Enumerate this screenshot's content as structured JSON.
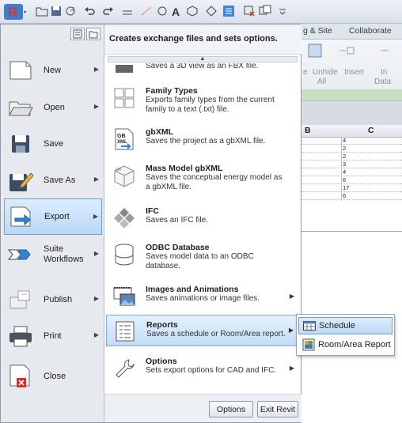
{
  "ribbon": {
    "tabs": [
      "g & Site",
      "Collaborate"
    ],
    "button_labels": [
      "e",
      "Unhide",
      "All",
      "Insert",
      "In",
      "Data"
    ]
  },
  "sheet": {
    "col_b": "B",
    "col_c": "C",
    "values": [
      "4",
      "2",
      "2",
      "3",
      "4",
      "6",
      "17",
      "6"
    ]
  },
  "menu": {
    "left_items": [
      {
        "label": "New",
        "has_arrow": true,
        "icon": "new-document-icon"
      },
      {
        "label": "Open",
        "has_arrow": true,
        "icon": "open-folder-icon"
      },
      {
        "label": "Save",
        "has_arrow": false,
        "icon": "floppy-disk-icon"
      },
      {
        "label": "Save As",
        "has_arrow": true,
        "icon": "save-as-icon"
      },
      {
        "label": "Export",
        "has_arrow": true,
        "icon": "export-icon",
        "active": true
      },
      {
        "label": "Suite Workflows",
        "has_arrow": true,
        "icon": "suite-workflows-icon"
      },
      {
        "label": "Publish",
        "has_arrow": true,
        "icon": "publish-icon"
      },
      {
        "label": "Print",
        "has_arrow": true,
        "icon": "printer-icon"
      },
      {
        "label": "Close",
        "has_arrow": false,
        "icon": "close-document-icon"
      }
    ],
    "right_header": "Creates exchange files and sets options.",
    "scroll_up": "▲",
    "right_items": [
      {
        "title": "",
        "desc": "Saves a 3D view as an FBX file.",
        "icon": "fbx-icon"
      },
      {
        "title": "Family Types",
        "desc": "Exports family types from the current family to a text (.txt) file.",
        "icon": "family-types-icon"
      },
      {
        "title": "gbXML",
        "desc": "Saves the project as a gbXML file.",
        "icon": "gbxml-icon"
      },
      {
        "title": "Mass Model gbXML",
        "desc": "Saves the conceptual energy model as a gbXML file.",
        "icon": "mass-model-gbxml-icon"
      },
      {
        "title": "IFC",
        "desc": "Saves an IFC file.",
        "icon": "ifc-icon"
      },
      {
        "title": "ODBC Database",
        "desc": "Saves model data to an ODBC database.",
        "icon": "database-icon"
      },
      {
        "title": "Images and Animations",
        "desc": "Saves animations or image files.",
        "icon": "images-animations-icon",
        "submenu": true
      },
      {
        "title": "Reports",
        "desc": "Saves a schedule or Room/Area report.",
        "icon": "reports-icon",
        "submenu": true,
        "selected": true
      },
      {
        "title": "Options",
        "desc": "Sets export options for CAD and IFC.",
        "icon": "options-wrench-icon",
        "submenu": true
      }
    ],
    "options_button": "Options",
    "exit_button": "Exit Revit"
  },
  "submenu": {
    "items": [
      {
        "label": "Schedule",
        "icon": "schedule-icon",
        "highlighted": true
      },
      {
        "label": "Room/Area Report",
        "icon": "room-area-report-icon"
      }
    ]
  },
  "colors": {
    "selection_blue": "#bcd9f5",
    "selection_border": "#6f9ed0",
    "menu_bg": "#e9edf2"
  }
}
